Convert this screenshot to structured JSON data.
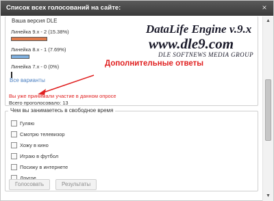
{
  "dialog": {
    "title": "Список всех голосований на сайте:",
    "close_glyph": "×"
  },
  "poll1": {
    "legend": "Ваша версия DLE",
    "options": [
      {
        "label": "Линейка 9.x - 2 (15.38%)",
        "percent": 15.38,
        "color": "#e07a4a"
      },
      {
        "label": "Линейка 8.x - 1 (7.69%)",
        "percent": 7.69,
        "color": "#7fb0e0"
      },
      {
        "label": "Линейка 7.x - 0 (0%)",
        "percent": 0,
        "color": "#333333"
      }
    ],
    "all_link": "Все варианты",
    "voted_msg": "Вы уже принимали участие в данном опросе",
    "total": "Всего проголосовало: 13"
  },
  "poll2": {
    "legend": "Чем вы занимаетесь в свободное время",
    "options": [
      "Гуляю",
      "Смотрю телевизор",
      "Хожу в кино",
      "Играю в футбол",
      "Посижу в интернете",
      "Другое"
    ],
    "vote_button": "Голосовать",
    "results_button": "Результаты"
  },
  "watermark": {
    "title": "DataLife Engine v.9.x",
    "url": "www.dle9.com",
    "group": "DLE SOFTNEWS MEDIA GROUP"
  },
  "annotation": "Дополнительные ответы",
  "scrollbar": {
    "up": "▲",
    "down": "▼"
  }
}
